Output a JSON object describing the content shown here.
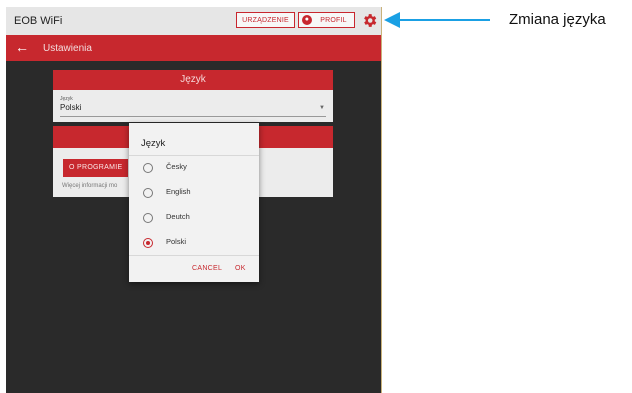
{
  "app": {
    "title": "EOB WiFi",
    "device_button": "URZĄDZENIE",
    "profile_button": "PROFIL",
    "settings_icon": "gear-icon",
    "accent_color": "#c7282e"
  },
  "nav": {
    "back_icon": "←",
    "title": "Ustawienia"
  },
  "language_card": {
    "header": "Język",
    "field_label": "Język",
    "field_value": "Polski"
  },
  "about_card": {
    "program_button": "O PROGRAMIE",
    "more_info": "Więcej informacji mo"
  },
  "dialog": {
    "title": "Język",
    "options": [
      {
        "label": "Česky",
        "selected": false
      },
      {
        "label": "English",
        "selected": false
      },
      {
        "label": "Deutch",
        "selected": false
      },
      {
        "label": "Polski",
        "selected": true
      }
    ],
    "cancel_label": "CANCEL",
    "ok_label": "OK"
  },
  "annotation": {
    "text": "Zmiana języka",
    "arrow_color": "#1aa0e4"
  }
}
